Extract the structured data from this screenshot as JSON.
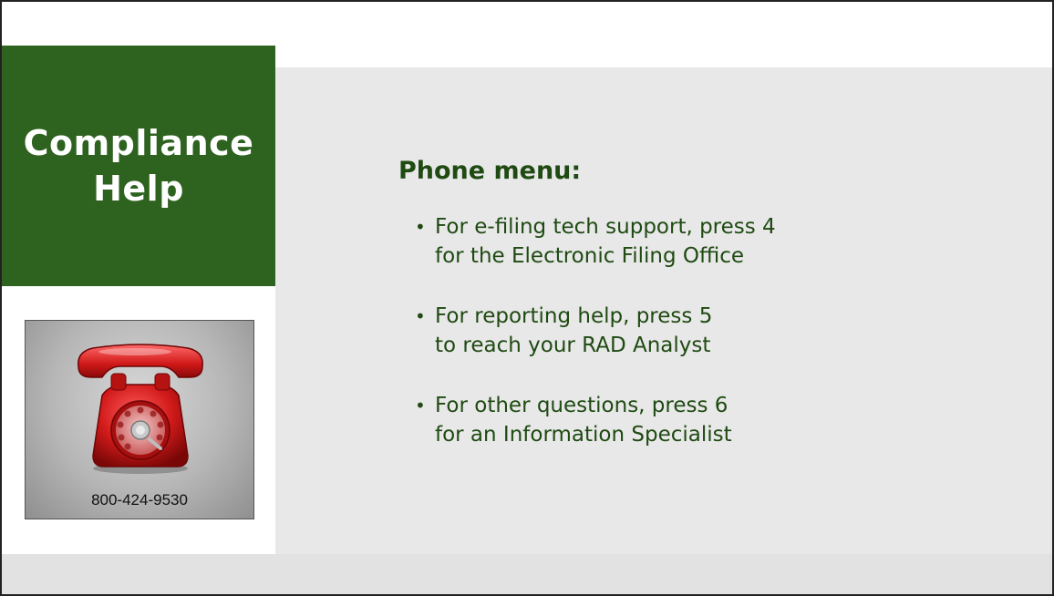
{
  "title": {
    "line1": "Compliance",
    "line2": "Help"
  },
  "phone_card": {
    "icon": "red-rotary-telephone-icon",
    "number": "800-424-9530"
  },
  "menu": {
    "heading": "Phone menu:",
    "items": [
      {
        "line1": "For e-filing tech support, press 4",
        "line2": "for the Electronic Filing Office"
      },
      {
        "line1": "For reporting help, press 5",
        "line2": "to reach your RAD Analyst"
      },
      {
        "line1": "For other questions, press 6",
        "line2": "for an Information Specialist"
      }
    ]
  },
  "colors": {
    "title_background": "#2e621f",
    "text_green": "#1f4a12",
    "panel_gray": "#e8e8e8",
    "phone_red": "#d11a1a"
  }
}
